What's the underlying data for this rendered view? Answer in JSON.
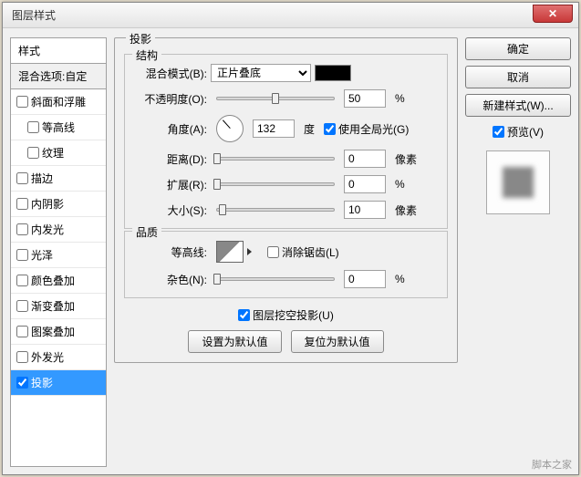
{
  "window": {
    "title": "图层样式"
  },
  "left": {
    "header": "样式",
    "subheader": "混合选项:自定",
    "items": [
      {
        "label": "斜面和浮雕",
        "checked": false,
        "indent": false
      },
      {
        "label": "等高线",
        "checked": false,
        "indent": true
      },
      {
        "label": "纹理",
        "checked": false,
        "indent": true
      },
      {
        "label": "描边",
        "checked": false,
        "indent": false
      },
      {
        "label": "内阴影",
        "checked": false,
        "indent": false
      },
      {
        "label": "内发光",
        "checked": false,
        "indent": false
      },
      {
        "label": "光泽",
        "checked": false,
        "indent": false
      },
      {
        "label": "颜色叠加",
        "checked": false,
        "indent": false
      },
      {
        "label": "渐变叠加",
        "checked": false,
        "indent": false
      },
      {
        "label": "图案叠加",
        "checked": false,
        "indent": false
      },
      {
        "label": "外发光",
        "checked": false,
        "indent": false
      },
      {
        "label": "投影",
        "checked": true,
        "indent": false,
        "selected": true
      }
    ]
  },
  "center": {
    "panel_title": "投影",
    "structure": {
      "title": "结构",
      "blend_mode_label": "混合模式(B):",
      "blend_mode_value": "正片叠底",
      "color": "#000000",
      "opacity_label": "不透明度(O):",
      "opacity_value": "50",
      "opacity_unit": "%",
      "angle_label": "角度(A):",
      "angle_value": "132",
      "angle_unit": "度",
      "global_light_label": "使用全局光(G)",
      "global_light_checked": true,
      "distance_label": "距离(D):",
      "distance_value": "0",
      "distance_unit": "像素",
      "spread_label": "扩展(R):",
      "spread_value": "0",
      "spread_unit": "%",
      "size_label": "大小(S):",
      "size_value": "10",
      "size_unit": "像素"
    },
    "quality": {
      "title": "品质",
      "contour_label": "等高线:",
      "antialias_label": "消除锯齿(L)",
      "antialias_checked": false,
      "noise_label": "杂色(N):",
      "noise_value": "0",
      "noise_unit": "%"
    },
    "knockout_label": "图层挖空投影(U)",
    "knockout_checked": true,
    "btn_default": "设置为默认值",
    "btn_reset": "复位为默认值"
  },
  "right": {
    "ok": "确定",
    "cancel": "取消",
    "new_style": "新建样式(W)...",
    "preview_label": "预览(V)",
    "preview_checked": true
  },
  "watermark": "脚本之家"
}
